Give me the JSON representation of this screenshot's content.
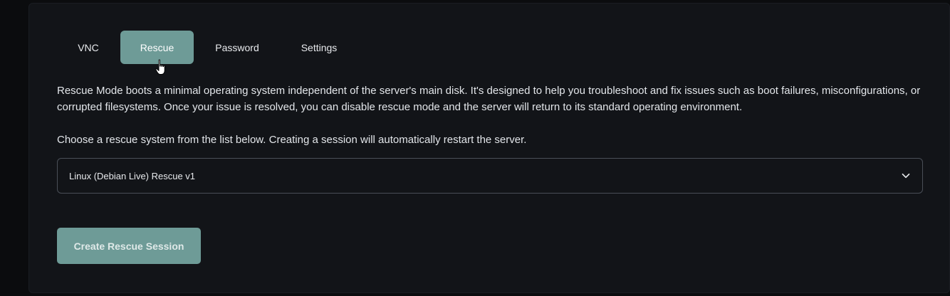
{
  "tabs": [
    {
      "label": "VNC",
      "active": false
    },
    {
      "label": "Rescue",
      "active": true
    },
    {
      "label": "Password",
      "active": false
    },
    {
      "label": "Settings",
      "active": false
    }
  ],
  "rescue": {
    "description": "Rescue Mode boots a minimal operating system independent of the server's main disk. It's designed to help you troubleshoot and fix issues such as boot failures, misconfigurations, or corrupted filesystems. Once your issue is resolved, you can disable rescue mode and the server will return to its standard operating environment.",
    "choose_text": "Choose a rescue system from the list below. Creating a session will automatically restart the server.",
    "select_value": "Linux (Debian Live) Rescue v1",
    "create_button_label": "Create Rescue Session"
  },
  "icons": {
    "select_arrow": "chevron-down-icon",
    "cursor": "hand-pointer-icon"
  },
  "colors": {
    "accent": "#6e9b97",
    "panel_bg": "#121418",
    "page_bg": "#0b0c0e"
  }
}
